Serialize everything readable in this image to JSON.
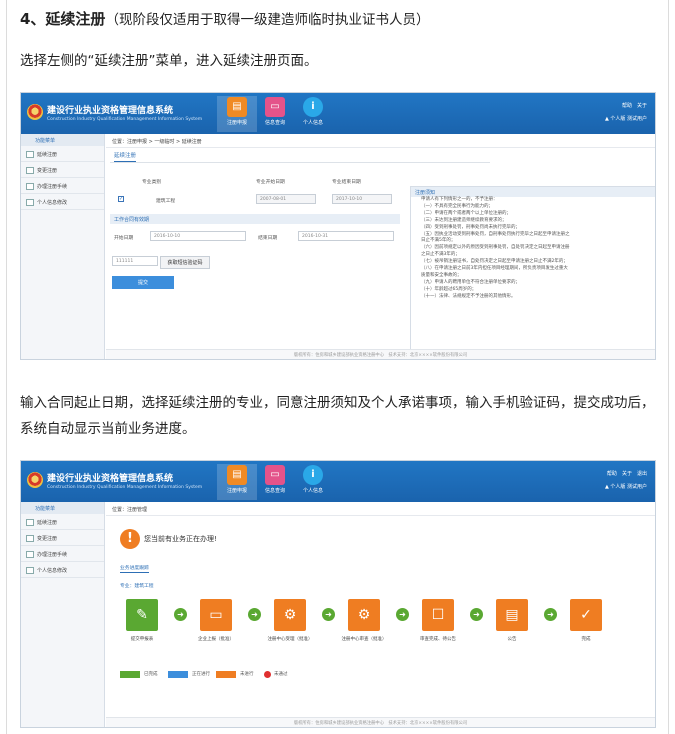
{
  "heading": {
    "main": "4、延续注册",
    "sub": "（现阶段仅适用于取得一级建造师临时执业证书人员）"
  },
  "para1": "选择左侧的“延续注册”菜单，进入延续注册页面。",
  "para2": "输入合同起止日期，选择延续注册的专业，同意注册须知及个人承诺事项，输入手机验证码，提交成功后，系统自动显示当前业务进度。",
  "system": {
    "title": "建设行业执业资格管理信息系统",
    "subtitle": "Construction Industry Qualification Management Information System",
    "nav": [
      {
        "label": "注册申报",
        "icon": "folder-icon"
      },
      {
        "label": "信息查询",
        "icon": "monitor-icon"
      },
      {
        "label": "个人信息",
        "icon": "info-icon"
      }
    ],
    "top_links": [
      "帮助",
      "关于",
      "退出"
    ],
    "user": "个人版 测试用户",
    "sidebar": {
      "header": "功能菜单",
      "items": [
        "延续注册",
        "变更注册",
        "办理注册手续",
        "个人信息修改"
      ]
    },
    "footer": "版权所有：住房和城乡建设部执业资格注册中心　技术支持：北京××××软件股份有限公司"
  },
  "shot1": {
    "breadcrumb": "位置：注册申报 > 一级临时 > 延续注册",
    "tab": "延续注册",
    "cols": [
      "专业类别",
      "专业开始日期",
      "专业结束日期"
    ],
    "row": {
      "major": "建筑工程",
      "start": "2007-08-01",
      "end": "2017-10-10"
    },
    "section": "工作合同有效期",
    "start_label": "开始日期",
    "start_value": "2016-10-10",
    "end_label": "结束日期",
    "end_value": "2016-10-31",
    "code_value": "111111",
    "code_btn": "获取短信验证码",
    "submit": "提交",
    "notice_title": "注册须知",
    "notice_lines": [
      "申请人有下列情形之一的，不予注册：",
      "（一）不具有完全民事行为能力的；",
      "（二）申请在两个或者两个以上单位注册的；",
      "（三）未达到注册建造师继续教育要求的；",
      "（四）受到刑事处罚，刑事处罚尚未执行完毕的；",
      "（五）因执业活动受到刑事处罚，自刑事处罚执行完毕之日起至申请注册之",
      "日止不满5年的；",
      "（六）因前项规定以外的原因受到刑事处罚，自处罚决定之日起至申请注册",
      "之日止不满3年的；",
      "（七）被吊销注册证书，自处罚决定之日起至申请注册之日止不满2年的；",
      "（八）在申请注册之日前3年内担任项目经理期间，所负责项目发生过重大",
      "质量和安全事故的；",
      "（九）申请人的聘用单位不符合注册单位要求的；",
      "（十）年龄超过65周岁的；",
      "（十一）法律、法规规定不予注册的其他情形。"
    ]
  },
  "shot2": {
    "breadcrumb": "位置：注册管理",
    "alert": "您当前有业务正在办理!",
    "progress_title": "业务进度跟踪",
    "major": "专业：建筑工程",
    "steps": [
      "提交申报表",
      "企业上报（批准）",
      "注册中心受理（批准）",
      "注册中心审查（批准）",
      "审查完成、待公告",
      "公告",
      "完成"
    ],
    "legend": [
      "已完成",
      "正在进行",
      "未进行",
      "未通过"
    ],
    "colors": {
      "done": "#5aa832",
      "doing": "#3c8edc",
      "todo": "#ef7d22",
      "fail": "#e03030"
    }
  }
}
